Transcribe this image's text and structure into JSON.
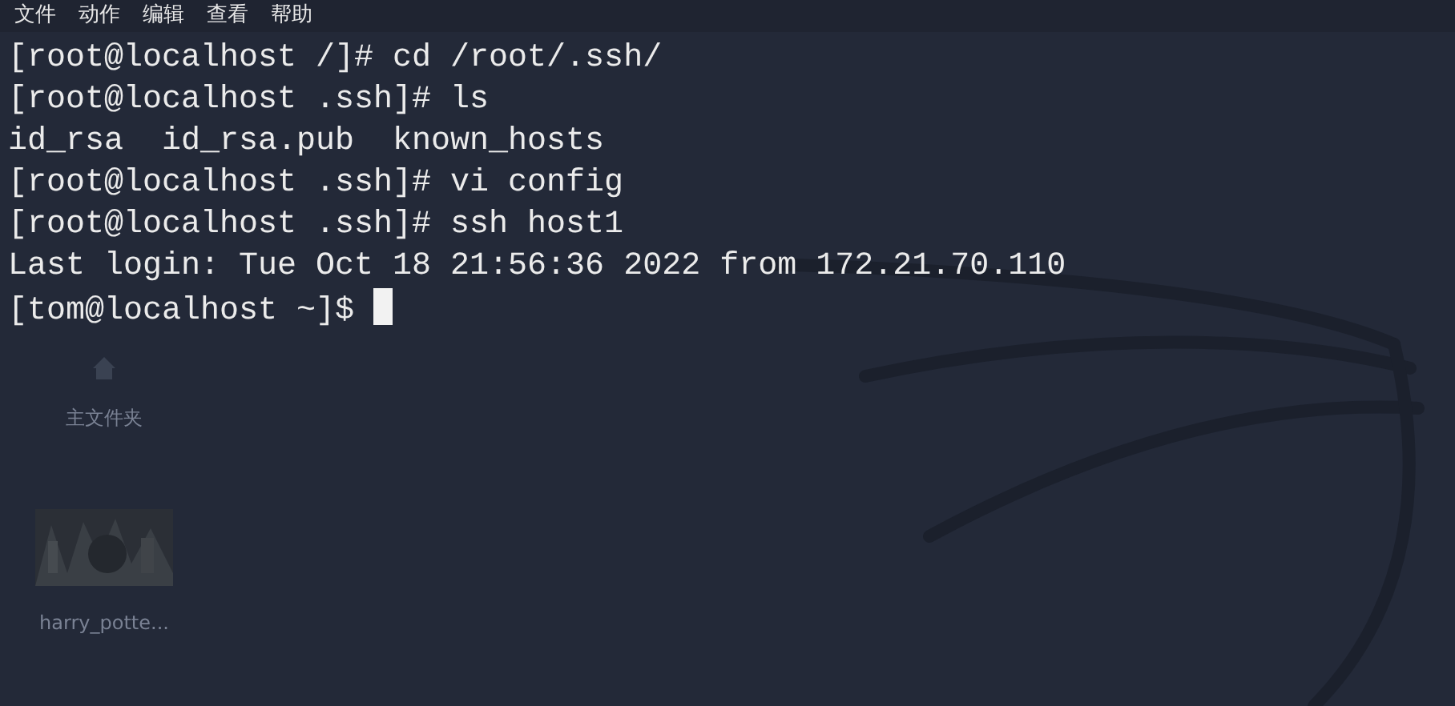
{
  "menu": [
    "文件",
    "动作",
    "编辑",
    "查看",
    "帮助"
  ],
  "desktop_items": [
    {
      "kind": "folder",
      "label": "主文件夹"
    },
    {
      "kind": "picture",
      "label": "harry_potte..."
    }
  ],
  "terminal_lines": [
    "[root@localhost /]# cd /root/.ssh/",
    "[root@localhost .ssh]# ls",
    "id_rsa  id_rsa.pub  known_hosts",
    "[root@localhost .ssh]# vi config",
    "[root@localhost .ssh]# ssh host1",
    "Last login: Tue Oct 18 21:56:36 2022 from 172.21.70.110",
    "[tom@localhost ~]$ "
  ]
}
